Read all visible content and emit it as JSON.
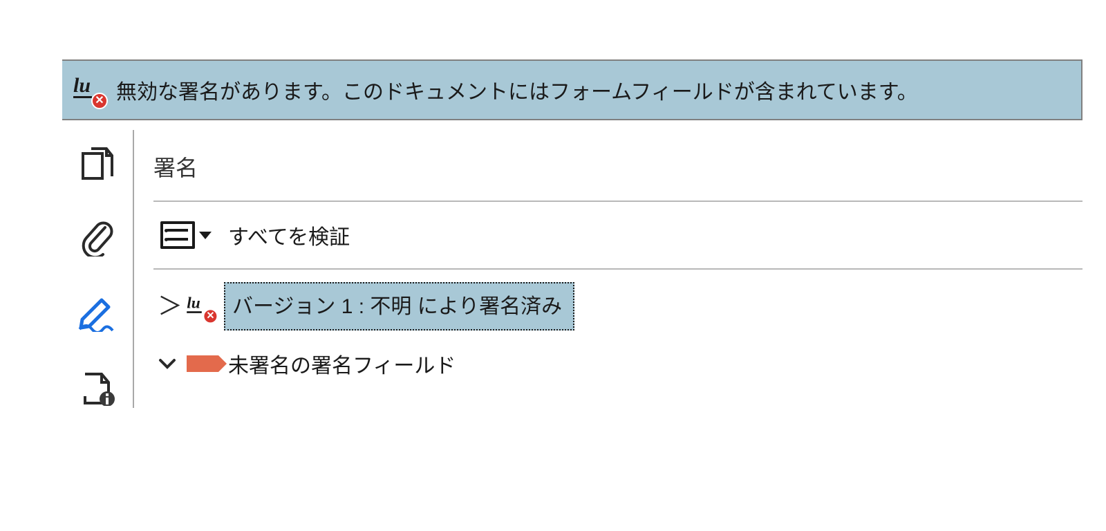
{
  "banner": {
    "message": "無効な署名があります。このドキュメントにはフォームフィールドが含まれています。"
  },
  "panel": {
    "title": "署名",
    "verify_all_label": "すべてを検証",
    "items": [
      {
        "label": "バージョン 1 : 不明 により署名済み",
        "expanded": false,
        "selected": true
      },
      {
        "label": "未署名の署名フィールド",
        "expanded": true,
        "selected": false
      }
    ]
  }
}
